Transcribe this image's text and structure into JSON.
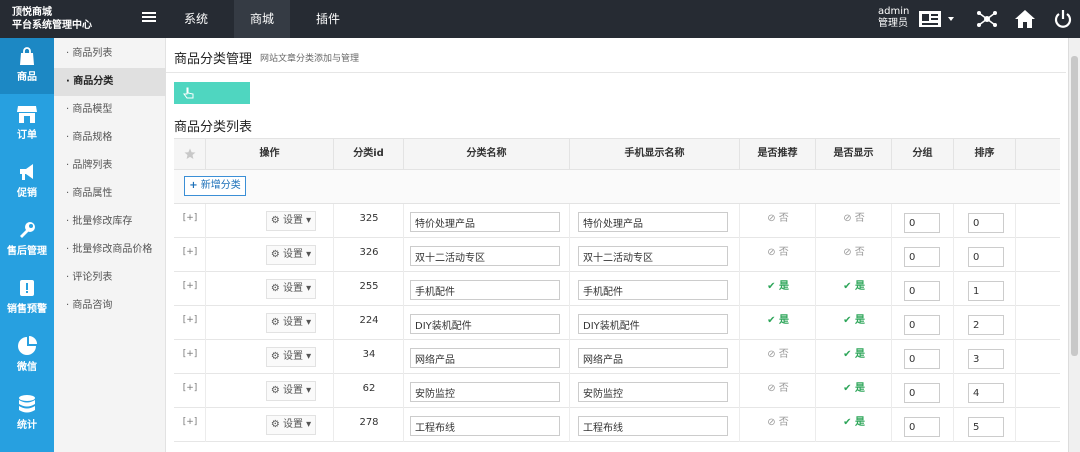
{
  "brand": {
    "line1": "顶悦商城",
    "line2": "平台系统管理中心"
  },
  "topnav": [
    {
      "label": "系统"
    },
    {
      "label": "商城"
    },
    {
      "label": "插件"
    }
  ],
  "user": {
    "name": "admin",
    "role": "管理员"
  },
  "leftbar": [
    {
      "label": "商品",
      "icon": "bag-icon"
    },
    {
      "label": "订单",
      "icon": "store-icon"
    },
    {
      "label": "促销",
      "icon": "megaphone-icon"
    },
    {
      "label": "售后管理",
      "icon": "wrench-icon"
    },
    {
      "label": "销售预警",
      "icon": "alert-icon"
    },
    {
      "label": "微信",
      "icon": "pie-icon"
    },
    {
      "label": "统计",
      "icon": "database-icon"
    }
  ],
  "subnav": [
    {
      "label": "· 商品列表"
    },
    {
      "label": "· 商品分类"
    },
    {
      "label": "· 商品模型"
    },
    {
      "label": "· 商品规格"
    },
    {
      "label": "· 品牌列表"
    },
    {
      "label": "· 商品属性"
    },
    {
      "label": "· 批量修改库存"
    },
    {
      "label": "· 批量修改商品价格"
    },
    {
      "label": "· 评论列表"
    },
    {
      "label": "· 商品咨询"
    }
  ],
  "page": {
    "title": "商品分类管理",
    "subtitle": "网站文章分类添加与管理",
    "list_title": "商品分类列表"
  },
  "table": {
    "headers": {
      "op": "操作",
      "id": "分类id",
      "name": "分类名称",
      "mobile": "手机显示名称",
      "recommend": "是否推荐",
      "show": "是否显示",
      "group": "分组",
      "sort": "排序"
    },
    "add_label": "新增分类",
    "expand_label": "[+]",
    "set_label": "设置",
    "yes_label": "是",
    "no_label": "否",
    "rows": [
      {
        "id": "325",
        "name": "特价处理产品",
        "mobile": "特价处理产品",
        "recommend": "no",
        "show": "no",
        "group": "0",
        "sort": "0"
      },
      {
        "id": "326",
        "name": "双十二活动专区",
        "mobile": "双十二活动专区",
        "recommend": "no",
        "show": "no",
        "group": "0",
        "sort": "0"
      },
      {
        "id": "255",
        "name": "手机配件",
        "mobile": "手机配件",
        "recommend": "yes",
        "show": "yes",
        "group": "0",
        "sort": "1"
      },
      {
        "id": "224",
        "name": "DIY装机配件",
        "mobile": "DIY装机配件",
        "recommend": "yes",
        "show": "yes",
        "group": "0",
        "sort": "2"
      },
      {
        "id": "34",
        "name": "网络产品",
        "mobile": "网络产品",
        "recommend": "no",
        "show": "yes",
        "group": "0",
        "sort": "3"
      },
      {
        "id": "62",
        "name": "安防监控",
        "mobile": "安防监控",
        "recommend": "no",
        "show": "yes",
        "group": "0",
        "sort": "4"
      },
      {
        "id": "278",
        "name": "工程布线",
        "mobile": "工程布线",
        "recommend": "no",
        "show": "yes",
        "group": "0",
        "sort": "5"
      }
    ]
  }
}
